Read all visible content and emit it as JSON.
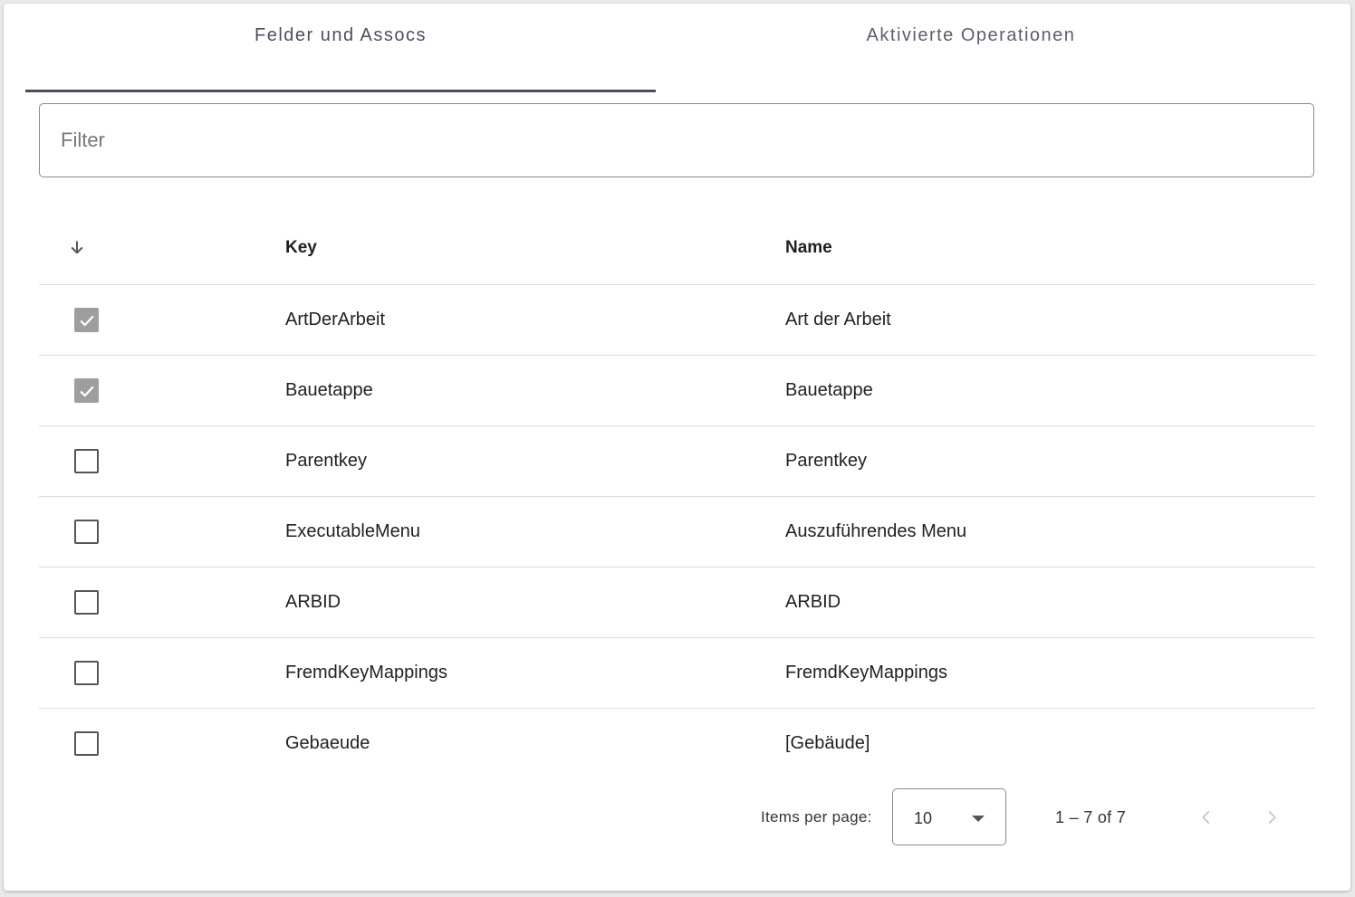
{
  "tabs": [
    {
      "label": "Felder und Assocs",
      "active": true
    },
    {
      "label": "Aktivierte Operationen",
      "active": false
    }
  ],
  "filter": {
    "placeholder": "Filter",
    "value": ""
  },
  "table": {
    "sort_icon": "arrow-down-icon",
    "headers": {
      "key": "Key",
      "name": "Name"
    },
    "rows": [
      {
        "key": "ArtDerArbeit",
        "name": "Art der Arbeit",
        "checked": true
      },
      {
        "key": "Bauetappe",
        "name": "Bauetappe",
        "checked": true
      },
      {
        "key": "Parentkey",
        "name": "Parentkey",
        "checked": false
      },
      {
        "key": "ExecutableMenu",
        "name": "Auszuführendes Menu",
        "checked": false
      },
      {
        "key": "ARBID",
        "name": "ARBID",
        "checked": false
      },
      {
        "key": "FremdKeyMappings",
        "name": "FremdKeyMappings",
        "checked": false
      },
      {
        "key": "Gebaeude",
        "name": "[Gebäude]",
        "checked": false
      }
    ]
  },
  "paginator": {
    "items_per_page_label": "Items per page:",
    "items_per_page_value": "10",
    "range_label": "1 – 7 of 7",
    "prev_icon": "chevron-left-icon",
    "next_icon": "chevron-right-icon"
  },
  "colors": {
    "tab_ink": "#4a4f60",
    "checkbox_checked": "#9e9e9e",
    "divider": "#dcdcdc"
  }
}
